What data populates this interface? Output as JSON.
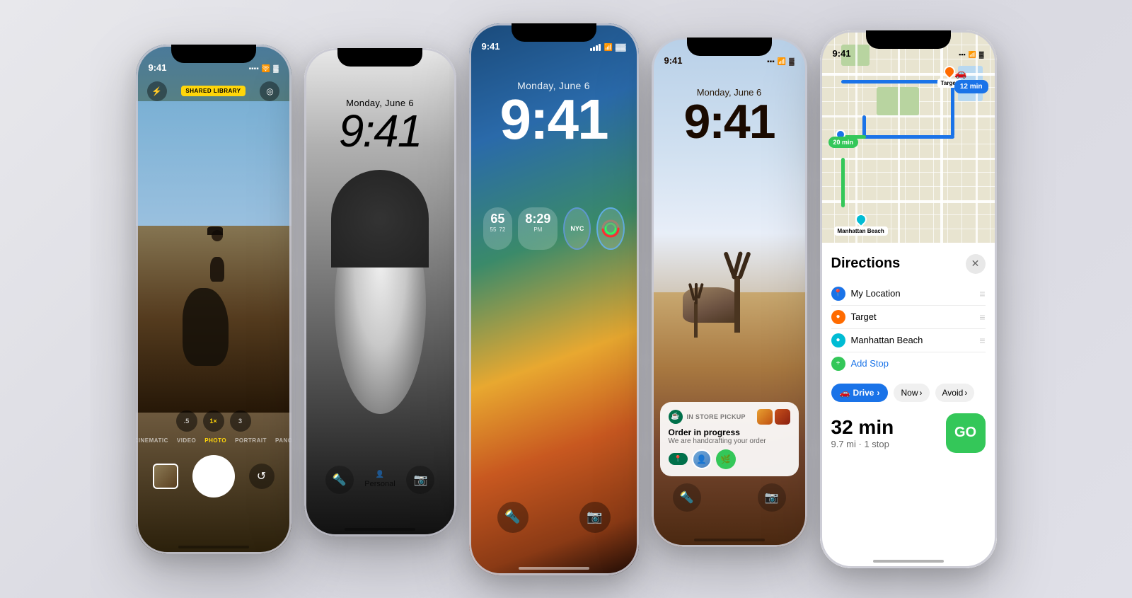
{
  "page": {
    "background": "light gray gradient"
  },
  "phone1": {
    "label": "camera-phone",
    "shared_library": "SHARED LIBRARY",
    "modes": [
      "CINEMATIC",
      "VIDEO",
      "PHOTO",
      "PORTRAIT",
      "PANO"
    ],
    "active_mode": "PHOTO",
    "zoom_levels": [
      ".5",
      "1×",
      "3"
    ],
    "active_zoom": "1×"
  },
  "phone2": {
    "label": "bw-lockscreen-phone",
    "day": "Monday, June 6",
    "time": "9:41",
    "bottom_left": "🔦",
    "bottom_label": "Personal",
    "bottom_right": "📷"
  },
  "phone3": {
    "label": "color-lockscreen-phone",
    "day": "Monday, June 6",
    "time": "9:41",
    "widget1_num": "65",
    "widget1_sub1": "55",
    "widget1_sub2": "72",
    "widget2_time": "8:29",
    "widget2_label": "PM",
    "widget3_label": "NYC",
    "bottom_left": "🔦",
    "bottom_right": "📷"
  },
  "phone4": {
    "label": "desert-lockscreen-phone",
    "day": "Monday, June 6",
    "time": "9:41",
    "notif_app": "In store pickup",
    "notif_title": "Order in progress",
    "notif_subtitle": "We are handcrafting your order",
    "bottom_left": "🔦",
    "bottom_right": "📷"
  },
  "phone5": {
    "label": "maps-phone",
    "status_time": "9:41",
    "eta_badge": "12 min",
    "eta_badge_2": "20 min",
    "directions_title": "Directions",
    "close_label": "✕",
    "waypoint1": "My Location",
    "waypoint2": "Target",
    "waypoint3": "Manhattan Beach",
    "add_stop": "Add Stop",
    "transport_mode": "Drive",
    "time_now": "Now",
    "avoid": "Avoid",
    "chevron": "›",
    "duration": "32 min",
    "distance": "9.7 mi · 1 stop",
    "go_label": "GO"
  }
}
